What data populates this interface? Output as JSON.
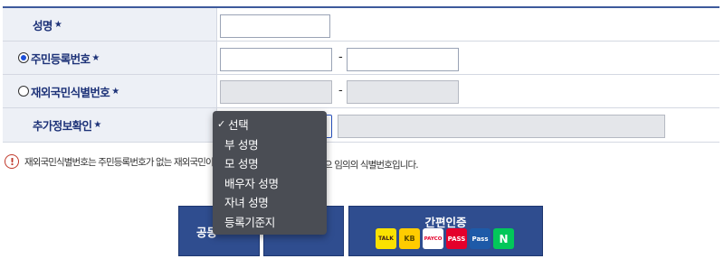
{
  "form": {
    "name_label": "성명",
    "rrn_label": "주민등록번호",
    "foreigner_label": "재외국민식별번호",
    "extra_label": "추가정보확인",
    "required_mark": "★",
    "dash": "-"
  },
  "radio": {
    "rrn_selected": true,
    "foreigner_selected": false
  },
  "dropdown": {
    "selected_index": 0,
    "check": "✓",
    "options": [
      "선택",
      "부 성명",
      "모 성명",
      "배우자 성명",
      "자녀 성명",
      "등록기준지"
    ]
  },
  "notice": {
    "icon": "!",
    "text": "재외국민식별번호는 주민등록번호가 없는 재외국민이",
    "tail": "으 임의의 식별번호입니다."
  },
  "buttons": {
    "left_label": "공동",
    "easy_auth_title": "간편인증",
    "logos": [
      "TALK",
      "KB",
      "PAYCO",
      "PASS",
      "Pass",
      "N"
    ]
  },
  "colors": {
    "header_blue": "#1d3278",
    "button_navy": "#2f4d8f",
    "dropdown_bg": "#4a4d54"
  }
}
